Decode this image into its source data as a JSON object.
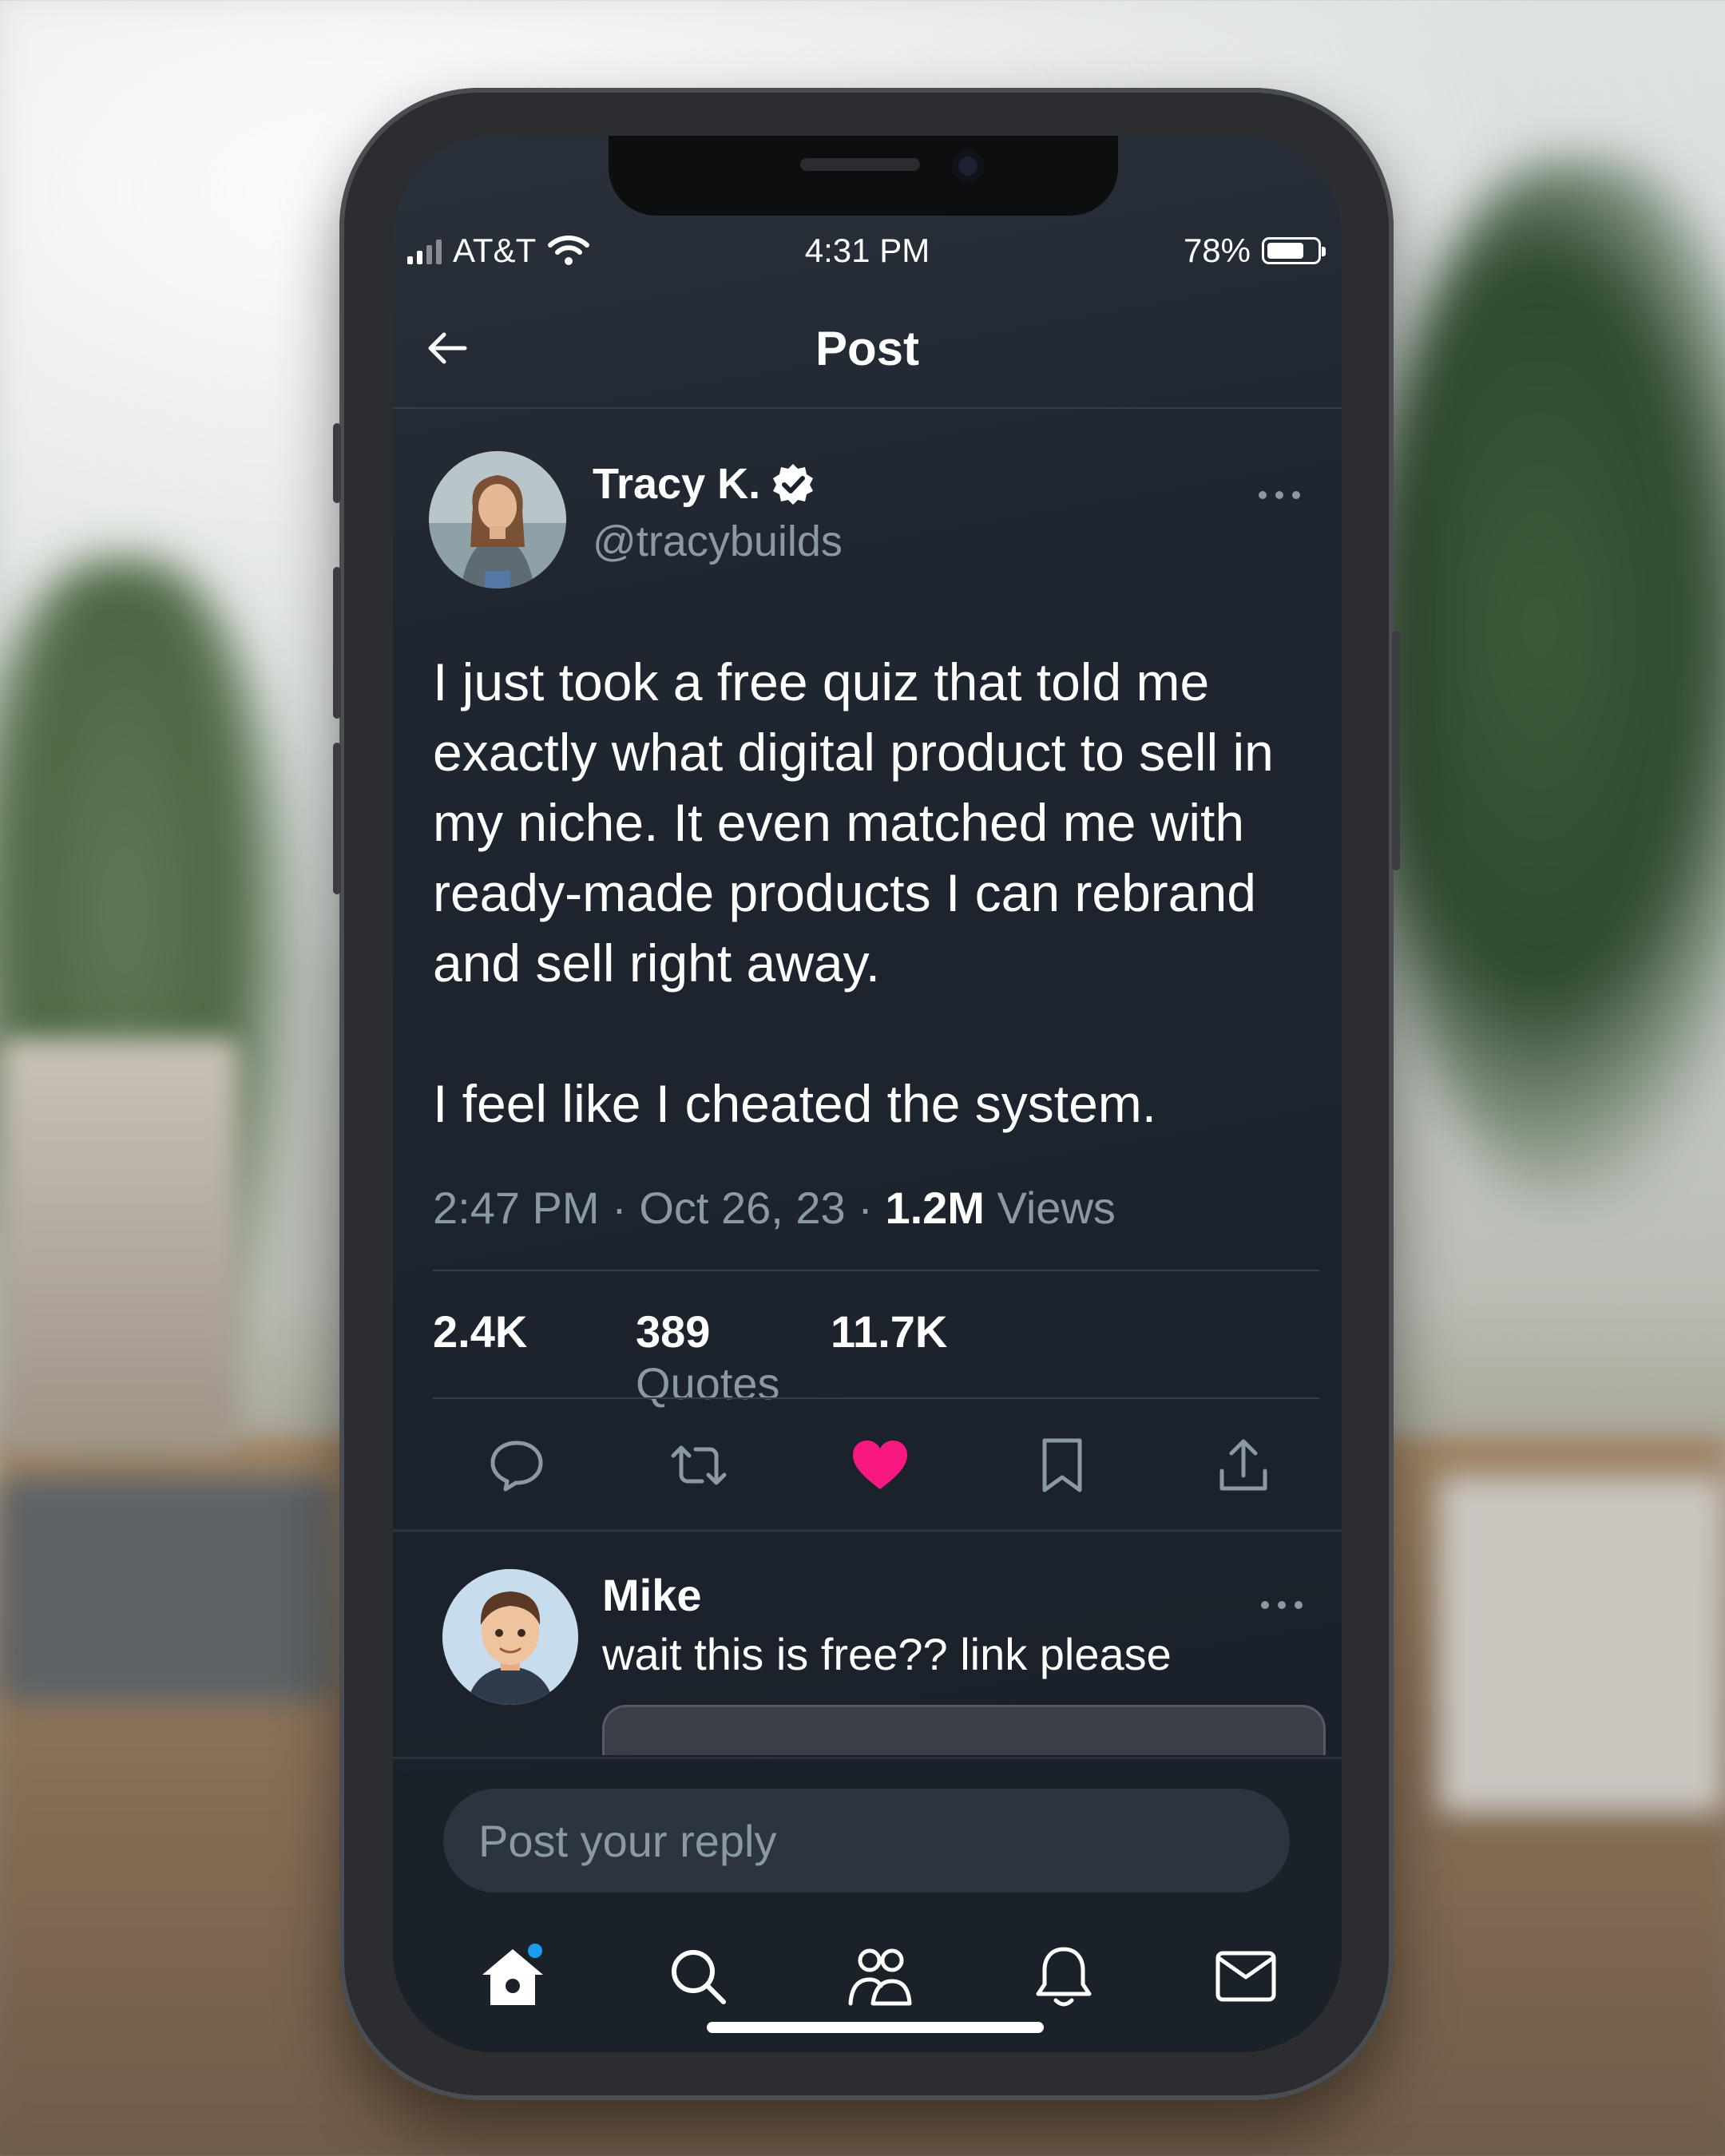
{
  "status_bar": {
    "carrier": "AT&T",
    "time": "4:31 PM",
    "battery_percent": "78%",
    "battery_level": 0.78
  },
  "header": {
    "title": "Post",
    "back_icon": "arrow-left-icon"
  },
  "post": {
    "author_name": "Tracy K.",
    "verified_icon": "verified-badge-icon",
    "handle": "@tracybuilds",
    "text_paragraph_1": "I just took a free quiz that told me exactly what digital product to sell in my niche. It even matched me with ready-made products I can rebrand and sell right away.",
    "text_paragraph_2": "I feel like I cheated the system.",
    "timestamp": "2:47 PM · Oct 26, 23 · ",
    "views_count": "1.2M",
    "views_label": " Views",
    "stats": {
      "reposts": "2.4K",
      "quotes_count": "389",
      "quotes_label": " Quotes",
      "likes": "11.7K"
    },
    "actions": [
      "reply-icon",
      "repost-icon",
      "like-icon",
      "bookmark-icon",
      "share-icon"
    ],
    "like_color": "#f91880"
  },
  "reply": {
    "author_name": "Mike",
    "text": "wait this is free?? link please"
  },
  "composer": {
    "placeholder": "Post your reply"
  },
  "tab_bar": {
    "tabs": [
      "home-icon",
      "search-icon",
      "communities-icon",
      "notifications-icon",
      "messages-icon"
    ],
    "accent_color": "#1d9bf0"
  }
}
